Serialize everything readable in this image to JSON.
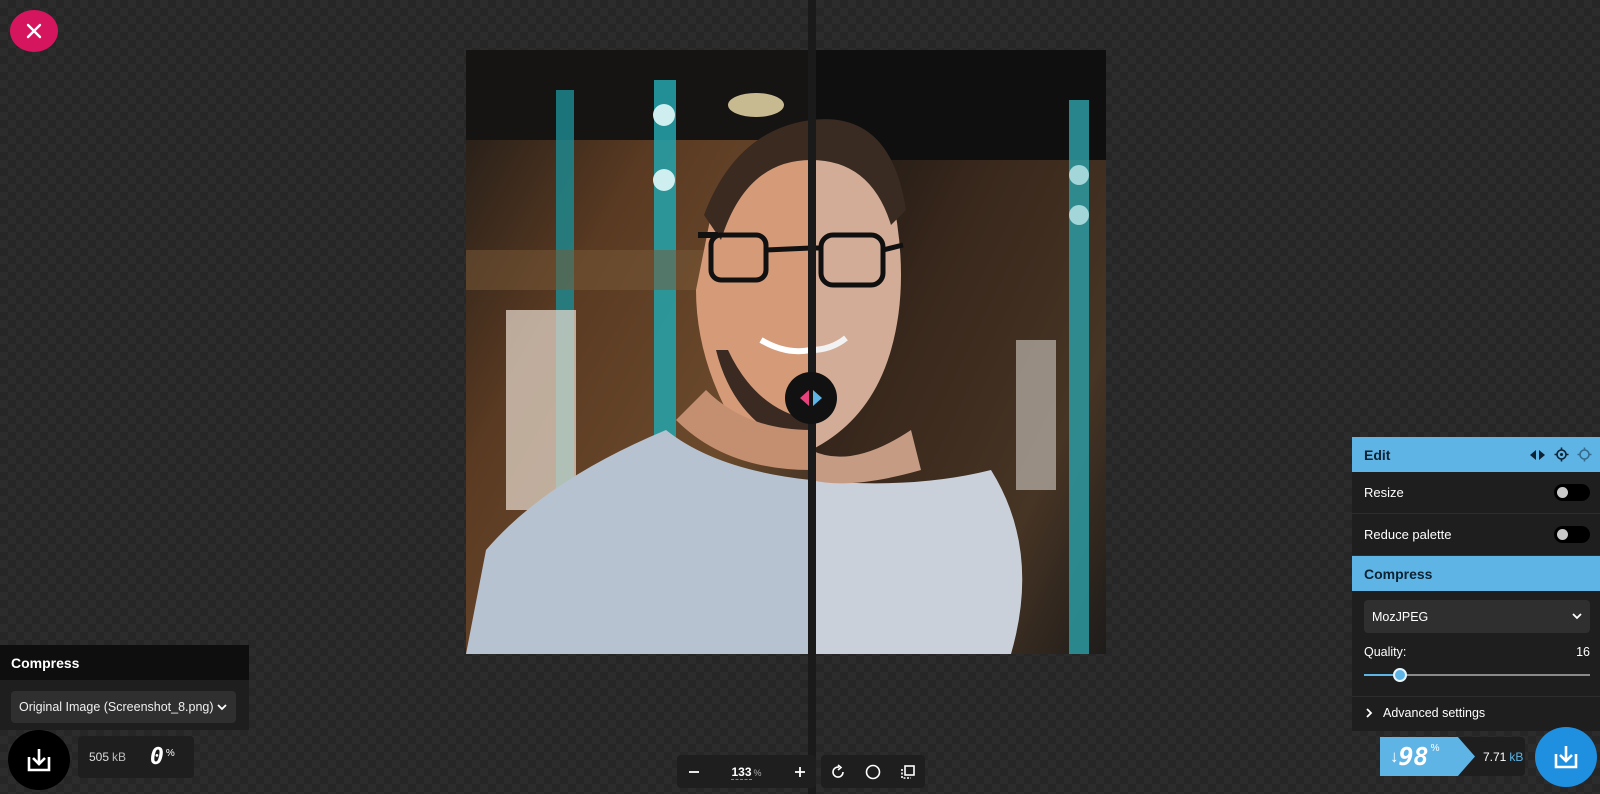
{
  "close_icon": "close-icon",
  "left_panel": {
    "title": "Compress",
    "select_value": "Original Image (Screenshot_8.png)",
    "size_value": "505",
    "size_unit": "kB",
    "percent_value": "0",
    "percent_sign": "%"
  },
  "toolbar": {
    "zoom_value": "133",
    "zoom_unit": "%"
  },
  "right_panel": {
    "edit_title": "Edit",
    "resize_label": "Resize",
    "reduce_palette_label": "Reduce palette",
    "compress_title": "Compress",
    "codec_value": "MozJPEG",
    "quality_label": "Quality:",
    "quality_value": "16",
    "quality_fraction": 0.16,
    "advanced_label": "Advanced settings",
    "saving_arrow": "↓",
    "saving_value": "98",
    "saving_sign": "%",
    "output_size": "7.71",
    "output_unit": "kB"
  },
  "colors": {
    "accent_blue": "#5fb4e6",
    "close_pink": "#d5155e",
    "download_blue": "#1f8fe0"
  }
}
